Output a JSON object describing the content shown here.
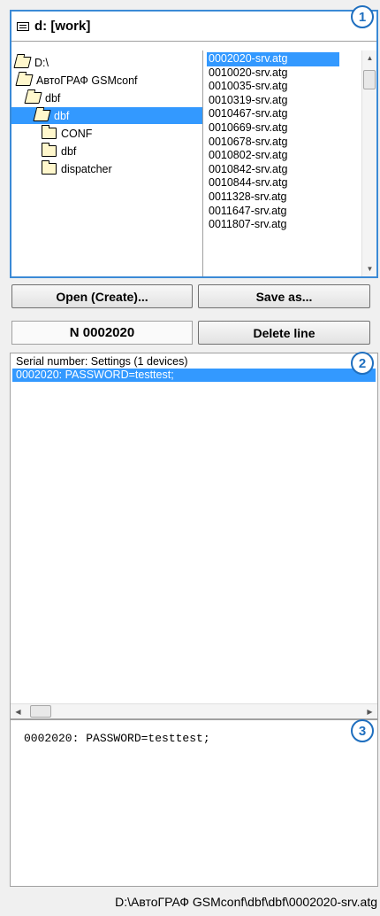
{
  "drive": {
    "label": "d: [work]"
  },
  "tree": {
    "nodes": [
      {
        "label": "D:\\"
      },
      {
        "label": "АвтоГРАФ GSMconf"
      },
      {
        "label": "dbf"
      },
      {
        "label": "dbf"
      },
      {
        "label": "CONF"
      },
      {
        "label": "dbf"
      },
      {
        "label": "dispatcher"
      }
    ]
  },
  "files": {
    "items": [
      "0002020-srv.atg",
      "0010020-srv.atg",
      "0010035-srv.atg",
      "0010319-srv.atg",
      "0010467-srv.atg",
      "0010669-srv.atg",
      "0010678-srv.atg",
      "0010802-srv.atg",
      "0010842-srv.atg",
      "0010844-srv.atg",
      "0011328-srv.atg",
      "0011647-srv.atg",
      "0011807-srv.atg"
    ]
  },
  "buttons": {
    "open_create": "Open (Create)...",
    "save_as": "Save as...",
    "delete_line": "Delete line"
  },
  "device_number": "N 0002020",
  "settings": {
    "header": "Serial number: Settings (1 devices)",
    "lines": [
      "0002020: PASSWORD=testtest;"
    ]
  },
  "preview": {
    "text": "0002020: PASSWORD=testtest;"
  },
  "status": {
    "path": "D:\\АвтоГРАФ GSMconf\\dbf\\dbf\\0002020-srv.atg"
  },
  "badges": [
    "1",
    "2",
    "3"
  ],
  "colors": {
    "selection": "#3399ff",
    "badge": "#1f6fbf",
    "panel_border": "#3b8ad6"
  },
  "icons": {
    "drive": "drive-icon",
    "folder_open": "folder-open-icon",
    "folder_closed": "folder-closed-icon"
  }
}
